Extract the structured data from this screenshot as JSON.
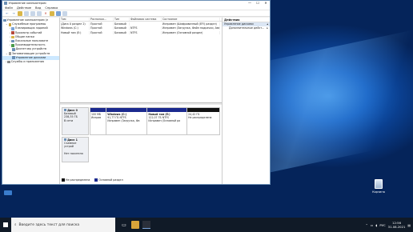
{
  "window": {
    "title": "Управление компьютером",
    "controls": [
      "—",
      "☐",
      "✕"
    ]
  },
  "menu": [
    "Файл",
    "Действие",
    "Вид",
    "Справка"
  ],
  "tree": [
    {
      "label": "Управление компьютером (л",
      "indent": 0,
      "color": "#6b8fb5"
    },
    {
      "label": "Служебные программы",
      "indent": 1,
      "color": "#c9a23c"
    },
    {
      "label": "Планировщик заданий",
      "indent": 2,
      "color": "#7aa3d8"
    },
    {
      "label": "Просмотр событий",
      "indent": 2,
      "color": "#b5493c"
    },
    {
      "label": "Общие папки",
      "indent": 2,
      "color": "#d9b648"
    },
    {
      "label": "Локальные пользовате",
      "indent": 2,
      "color": "#6b8fb5"
    },
    {
      "label": "Производительность",
      "indent": 2,
      "color": "#4a9a4a"
    },
    {
      "label": "Диспетчер устройств",
      "indent": 2,
      "color": "#6b8fb5"
    },
    {
      "label": "Запоминающие устройств",
      "indent": 1,
      "color": "#9a9a9a"
    },
    {
      "label": "Управление дисками",
      "indent": 2,
      "color": "#6b8fb5",
      "selected": true
    },
    {
      "label": "Службы и приложения",
      "indent": 1,
      "color": "#8a8a8a"
    }
  ],
  "volumes": {
    "headers": [
      "Том",
      "Располож...",
      "Тип",
      "Файловая система",
      "Состояние"
    ],
    "rows": [
      [
        "(Диск 0 раздел 2)",
        "Простой",
        "Базовый",
        "",
        "Исправен (Шифрованный (EFI) раздел)"
      ],
      [
        "Windows (C:)",
        "Простой",
        "Базовый",
        "NTFS",
        "Исправен (Загрузка, Файл подкачки, Ава"
      ],
      [
        "Новый том (E:)",
        "Простой",
        "Базовый",
        "NTFS",
        "Исправен (Основной раздел)"
      ]
    ]
  },
  "disks": [
    {
      "name": "Диск 0",
      "type": "Базовый",
      "size": "238,35 ГБ",
      "status": "В сети",
      "parts": [
        {
          "title": "",
          "size": "100 МБ",
          "status": "Исправ",
          "kind": "primary",
          "flex": 13
        },
        {
          "title": "Windows (C:)",
          "size": "91,77 ГБ NTFS",
          "status": "Исправен (Загрузка, Фа",
          "kind": "primary",
          "flex": 34
        },
        {
          "title": "Новый том (E:)",
          "size": "122,07 ГБ NTFS",
          "status": "Исправен (Основной ра",
          "kind": "primary",
          "flex": 33
        },
        {
          "title": "",
          "size": "24,42 ГБ",
          "status": "Не распределена",
          "kind": "unallocated",
          "flex": 27
        }
      ]
    },
    {
      "name": "Диск 1",
      "type": "Съемное устрой",
      "size": "",
      "status": "Нет носителя",
      "parts": []
    }
  ],
  "legend": {
    "unallocated": "Не распределена",
    "primary": "Основной раздел"
  },
  "actions": {
    "header": "Действия",
    "sub": "Управление дисками",
    "more": "Дополнительные дейст..."
  },
  "desktop": {
    "recycle": "Корзина"
  },
  "taskbar": {
    "search_placeholder": "Введите здесь текст для поиска",
    "lang": "РУС",
    "time": "12:56",
    "date": "31.08.2021"
  },
  "colors": {
    "primary": "#1b2a8e",
    "unallocated": "#111111",
    "selection": "#cce8ff"
  }
}
